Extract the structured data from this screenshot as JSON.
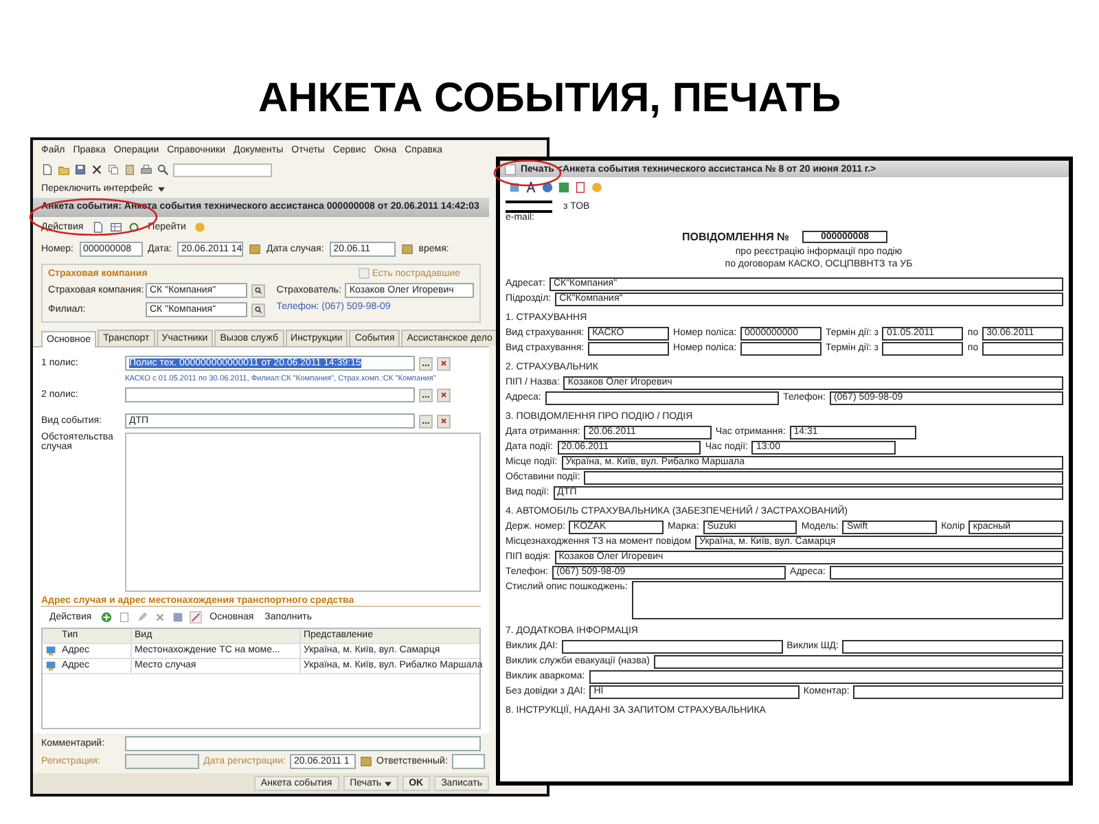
{
  "slide_title": "АНКЕТА СОБЫТИЯ, ПЕЧАТЬ",
  "form": {
    "menu": [
      "Файл",
      "Правка",
      "Операции",
      "Справочники",
      "Документы",
      "Отчеты",
      "Сервис",
      "Окна",
      "Справка"
    ],
    "interface_switch": "Переключить интерфейс",
    "title": "Анкета события: Анкета события технического ассистанса 000000008 от 20.06.2011 14:42:03",
    "actions": "Действия",
    "goto": "Перейти",
    "header_fields": [
      {
        "label": "Номер:",
        "value": "000000008",
        "kind": "text"
      },
      {
        "label": "Дата:",
        "value": "20.06.2011 14",
        "kind": "date"
      },
      {
        "label": "Дата случая:",
        "value": "20.06.11",
        "kind": "date"
      }
    ],
    "time_label": "время:",
    "insurer": {
      "title": "Страховая компания",
      "victims": {
        "label": "Есть пострадавшие",
        "checked": false,
        "disabled": true
      },
      "company": {
        "label": "Страховая компания:",
        "value": "СК \"Компания\""
      },
      "branch": {
        "label": "Филиал:",
        "value": "СК \"Компания\""
      },
      "policyholder": {
        "label": "Страхователь:",
        "value": "Козаков Олег Игоревич"
      },
      "phone": "Телефон: (067) 509-98-09"
    },
    "tabs": [
      {
        "label": "Основное",
        "selected": true
      },
      {
        "label": "Транспорт",
        "selected": false
      },
      {
        "label": "Участники",
        "selected": false
      },
      {
        "label": "Вызов служб",
        "selected": false
      },
      {
        "label": "Инструкции",
        "selected": false
      },
      {
        "label": "События",
        "selected": false
      },
      {
        "label": "Ассистанское дело",
        "selected": false
      }
    ],
    "policy1": {
      "label": "1 полис:",
      "value": "Полис тех. 000000000000011 от 20.06.2011 14:39:15",
      "selected": true
    },
    "policy_info": "КАСКО с 01.05.2011 по 30.06.2011, Филиал:СК \"Компания\", Страх.комп.:СК \"Компания\"",
    "policy2": {
      "label": "2 полис:"
    },
    "event_type": {
      "label": "Вид события:",
      "value": "ДТП"
    },
    "circumstances": {
      "label": "Обстоятельства случая"
    },
    "address_title": "Адрес случая и адрес местонахождения транспортного средства",
    "table_toolbar": {
      "actions": "Действия",
      "main": "Основная",
      "fill": "Заполнить"
    },
    "table": {
      "columns": [
        "Тип",
        "Вид",
        "Представление"
      ],
      "rows": [
        {
          "cells": [
            "Адрес",
            "Местонахождение ТС на моме...",
            "Україна, м. Київ, вул. Самарця"
          ]
        },
        {
          "cells": [
            "Адрес",
            "Место случая",
            "Україна, м. Київ, вул. Рибалко Маршала"
          ]
        }
      ]
    },
    "comment": {
      "label": "Комментарий:"
    },
    "registration": {
      "label": "Регистрация:",
      "disabled": true
    },
    "reg_date": {
      "label": "Дата регистрации:",
      "value": "20.06.2011 1"
    },
    "responsible": {
      "label": "Ответственный:"
    },
    "buttons": [
      {
        "label": "Анкета события",
        "kind": "plain"
      },
      {
        "label": "Печать",
        "kind": "menu"
      },
      {
        "label": "OK",
        "kind": "default"
      },
      {
        "label": "Записать",
        "kind": "plain"
      }
    ]
  },
  "print": {
    "title": "Печать <Анкета события технического ассистанса № 8 от 20 июня 2011 г.>",
    "sender": "з ТОВ",
    "email": "e-mail:",
    "heading": "ПОВІДОМЛЕННЯ №",
    "number": "000000008",
    "subtitle": [
      "про реєстрацію інформації про подію",
      "по договорам КАСКО, ОСЦПВВНТЗ та УБ"
    ],
    "sections": [
      {
        "lines": [
          {
            "fields": [
              {
                "kind": "line",
                "label": "Адресат:",
                "value": "СК\"Компания\""
              }
            ]
          },
          {
            "fields": [
              {
                "kind": "line",
                "label": "Підрозділ:",
                "value": "СК\"Компания\""
              }
            ]
          }
        ]
      },
      {
        "title": "1. СТРАХУВАННЯ",
        "lines": [
          {
            "fields": [
              {
                "kind": "line",
                "label": "Вид страхування:",
                "value": "КАСКО"
              },
              {
                "kind": "line",
                "label": "Номер поліса:",
                "value": "0000000000"
              },
              {
                "kind": "line",
                "label": "Термін дії: з",
                "value": "01.05.2011"
              },
              {
                "kind": "line",
                "label": "по",
                "value": "30.06.2011"
              }
            ]
          },
          {
            "fields": [
              {
                "kind": "line",
                "label": "Вид страхування:"
              },
              {
                "kind": "line",
                "label": "Номер поліса:"
              },
              {
                "kind": "line",
                "label": "Термін дії: з"
              },
              {
                "kind": "line",
                "label": "по"
              }
            ]
          }
        ]
      },
      {
        "title": "2. СТРАХУВАЛЬНИК",
        "lines": [
          {
            "fields": [
              {
                "kind": "line",
                "label": "ПІП / Назва:",
                "value": "Козаков Олег Игоревич"
              }
            ]
          },
          {
            "fields": [
              {
                "kind": "line",
                "label": "Адреса:"
              },
              {
                "kind": "line",
                "label": "Телефон:",
                "value": "(067) 509-98-09"
              }
            ]
          }
        ]
      },
      {
        "title": "3. ПОВІДОМЛЕННЯ ПРО ПОДІЮ / ПОДІЯ",
        "lines": [
          {
            "fields": [
              {
                "kind": "line",
                "label": "Дата отримання:",
                "value": "20.06.2011"
              },
              {
                "kind": "line",
                "label": "Час отримання:",
                "value": "14:31"
              },
              {
                "kind": "spacer"
              }
            ]
          },
          {
            "fields": [
              {
                "kind": "line",
                "label": "Дата події:",
                "value": "20.06.2011"
              },
              {
                "kind": "line",
                "label": "Час події:",
                "value": "13:00"
              },
              {
                "kind": "spacer"
              }
            ]
          },
          {
            "fields": [
              {
                "kind": "line",
                "label": "Місце події:",
                "value": "Україна, м. Київ, вул. Рибалко Маршала"
              }
            ]
          },
          {
            "fields": [
              {
                "kind": "line",
                "label": "Обставини події:"
              }
            ]
          },
          {
            "fields": [
              {
                "kind": "line",
                "label": "Вид події:",
                "value": "ДТП"
              }
            ]
          }
        ]
      },
      {
        "title": "4. АВТОМОБІЛЬ СТРАХУВАЛЬНИКА (ЗАБЕЗПЕЧЕНИЙ / ЗАСТРАХОВАНИЙ)",
        "lines": [
          {
            "fields": [
              {
                "kind": "line",
                "label": "Держ. номер:",
                "value": "KOZAK"
              },
              {
                "kind": "line",
                "label": "Марка:",
                "value": "Suzuki"
              },
              {
                "kind": "line",
                "label": "Модель:",
                "value": "Swift"
              },
              {
                "kind": "line",
                "label": "Колір",
                "value": "красный"
              }
            ]
          },
          {
            "fields": [
              {
                "kind": "line",
                "label": "Місцезнаходження ТЗ на момент повідом",
                "value": "Україна, м. Київ, вул. Самарця"
              }
            ]
          },
          {
            "fields": [
              {
                "kind": "line",
                "label": "ПІП водія:",
                "value": "Козаков Олег Игоревич"
              }
            ]
          },
          {
            "fields": [
              {
                "kind": "line",
                "label": "Телефон:",
                "value": "(067) 509-98-09"
              },
              {
                "kind": "line",
                "label": "Адреса:"
              }
            ]
          },
          {
            "fields": [
              {
                "kind": "area",
                "label": "Стислий опис пошкоджень:"
              }
            ]
          }
        ]
      },
      {
        "title": "7. ДОДАТКОВА ІНФОРМАЦІЯ",
        "lines": [
          {
            "fields": [
              {
                "kind": "line",
                "label": "Виклик ДАІ:"
              },
              {
                "kind": "line",
                "label": "Виклик ШД:"
              }
            ]
          },
          {
            "fields": [
              {
                "kind": "line",
                "label": "Виклик служби евакуації (назва)"
              }
            ]
          },
          {
            "fields": [
              {
                "kind": "line",
                "label": "Виклик аваркома:"
              }
            ]
          },
          {
            "fields": [
              {
                "kind": "line",
                "label": "Без довідки з ДАІ:",
                "value": "НІ"
              },
              {
                "kind": "line",
                "label": "Коментар:"
              }
            ]
          }
        ]
      },
      {
        "title": "8. ІНСТРУКЦІЇ, НАДАНІ ЗА ЗАПИТОМ СТРАХУВАЛЬНИКА"
      }
    ]
  }
}
